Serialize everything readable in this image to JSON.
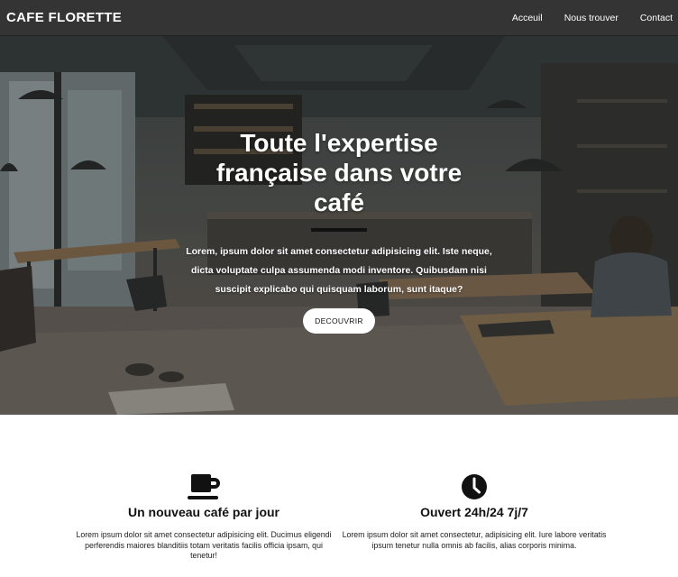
{
  "nav": {
    "brand": "CAFE FLORETTE",
    "links": [
      {
        "label": "Acceuil"
      },
      {
        "label": "Nous trouver"
      },
      {
        "label": "Contact"
      }
    ]
  },
  "hero": {
    "title": "Toute l'expertise française dans votre café",
    "text": "Lorem, ipsum dolor sit amet consectetur adipisicing elit. Iste neque, dicta voluptate culpa assumenda modi inventore. Quibusdam nisi suscipit explicabo qui quisquam laborum, sunt itaque?",
    "button": "DECOUVRIR"
  },
  "features": [
    {
      "icon": "coffee-cup-icon",
      "title": "Un nouveau café par jour",
      "text": "Lorem ipsum dolor sit amet consectetur adipisicing elit. Ducimus eligendi perferendis maiores blanditiis totam veritatis facilis officia ipsam, qui tenetur!"
    },
    {
      "icon": "clock-icon",
      "title": "Ouvert 24h/24 7j/7",
      "text": "Lorem ipsum dolor sit amet consectetur, adipisicing elit. Iure labore veritatis ipsum tenetur nulla omnis ab facilis, alias corporis minima."
    }
  ],
  "colors": {
    "navbar_bg": "#343434",
    "text_dark": "#111111",
    "hero_underline": "#111111"
  }
}
